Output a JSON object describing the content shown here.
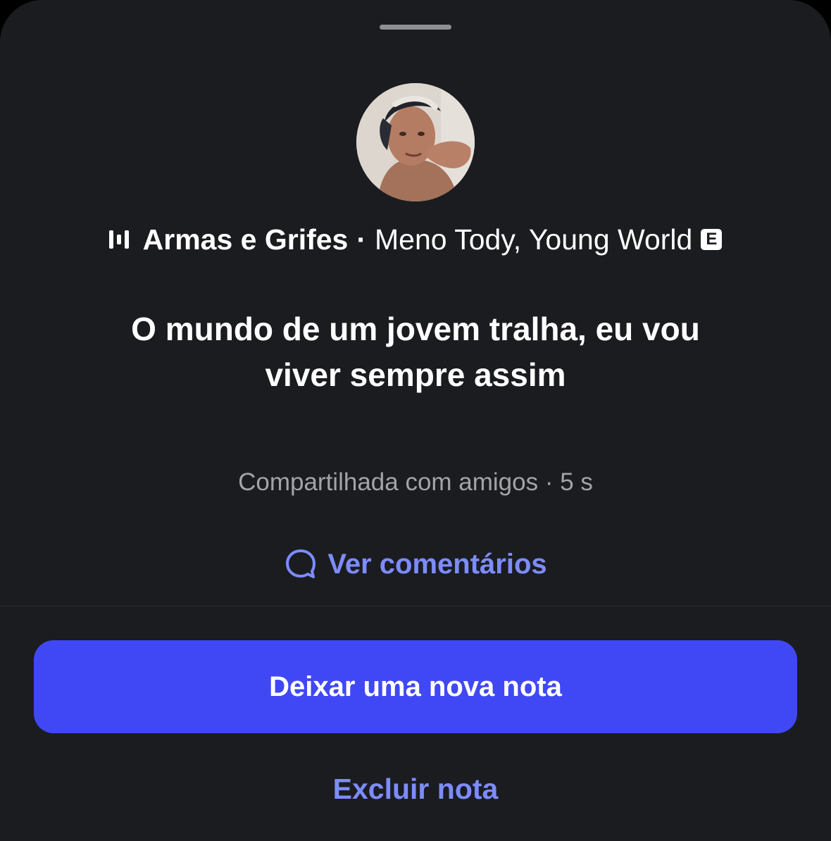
{
  "sheet": {
    "song": {
      "icon": "music-bars-icon",
      "title": "Armas e Grifes",
      "separator": "·",
      "artist": "Meno Tody, Young World",
      "explicit_badge": "E"
    },
    "note_text": "O mundo de um jovem tralha, eu vou viver sempre assim",
    "meta": "Compartilhada com amigos · 5 s",
    "comments_link": {
      "icon": "comment-bubble-icon",
      "label": "Ver comentários"
    },
    "primary_button": "Deixar uma nova nota",
    "secondary_button": "Excluir nota"
  },
  "colors": {
    "background": "#1b1c20",
    "accent_button": "#4048f5",
    "link": "#7d8cff",
    "muted_text": "#a3a4a8"
  }
}
